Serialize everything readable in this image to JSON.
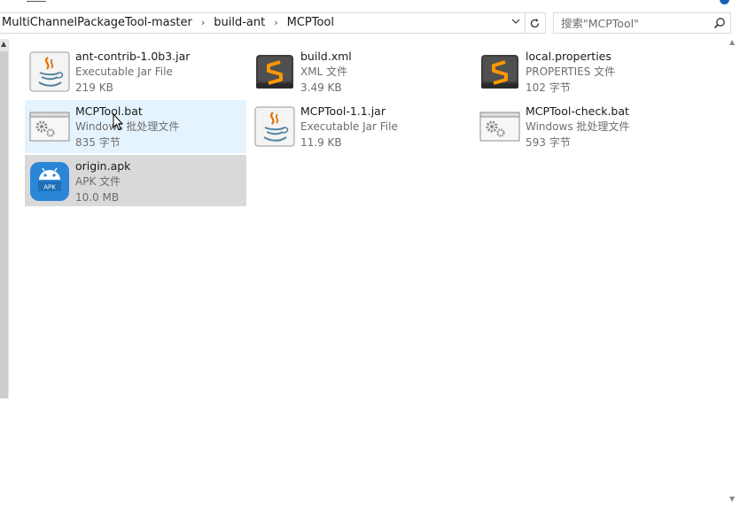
{
  "address_bar": {
    "breadcrumbs": [
      "MultiChannelPackageTool-master",
      "build-ant",
      "MCPTool"
    ]
  },
  "search": {
    "placeholder": "搜索\"MCPTool\""
  },
  "files": [
    {
      "name": "ant-contrib-1.0b3.jar",
      "type": "Executable Jar File",
      "size": "219 KB",
      "icon": "java-jar-icon"
    },
    {
      "name": "build.xml",
      "type": "XML 文件",
      "size": "3.49 KB",
      "icon": "sublime-text-icon"
    },
    {
      "name": "local.properties",
      "type": "PROPERTIES 文件",
      "size": "102 字节",
      "icon": "sublime-text-icon"
    },
    {
      "name": "MCPTool.bat",
      "type": "Windows 批处理文件",
      "size": "835 字节",
      "icon": "batch-file-icon",
      "state": "hover"
    },
    {
      "name": "MCPTool-1.1.jar",
      "type": "Executable Jar File",
      "size": "11.9 KB",
      "icon": "java-jar-icon"
    },
    {
      "name": "MCPTool-check.bat",
      "type": "Windows 批处理文件",
      "size": "593 字节",
      "icon": "batch-file-icon"
    },
    {
      "name": "origin.apk",
      "type": "APK 文件",
      "size": "10.0 MB",
      "icon": "android-apk-icon",
      "state": "selected",
      "icon_label": "APK"
    }
  ],
  "colors": {
    "hover_bg": "#e5f3ff",
    "selected_bg": "#d9d9d9",
    "apk_blue": "#2b86d6",
    "secondary_text": "#6d6d6d"
  }
}
